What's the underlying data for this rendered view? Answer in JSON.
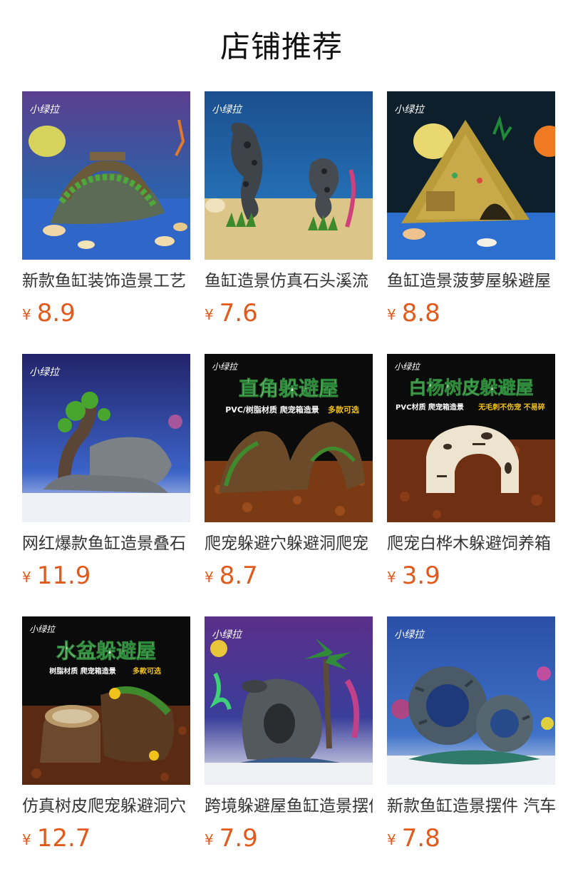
{
  "section": {
    "title": "店铺推荐"
  },
  "brand": {
    "logo_text": "小绿拉"
  },
  "colors": {
    "price": "#e05a1c",
    "title": "#111111",
    "name": "#333333"
  },
  "products": [
    {
      "name": "新款鱼缸装饰造景工艺",
      "currency": "¥",
      "price": "8.9",
      "image_icon": "aquarium-bridge-ornament-image"
    },
    {
      "name": "鱼缸造景仿真石头溪流",
      "currency": "¥",
      "price": "7.6",
      "image_icon": "aquarium-rock-ornament-image"
    },
    {
      "name": "鱼缸造景菠萝屋躲避屋",
      "currency": "¥",
      "price": "8.8",
      "image_icon": "aquarium-treasure-pyramid-image"
    },
    {
      "name": "网红爆款鱼缸造景叠石",
      "currency": "¥",
      "price": "11.9",
      "image_icon": "aquarium-tree-rock-image"
    },
    {
      "name": "爬宠躲避穴躲避洞爬宠",
      "currency": "¥",
      "price": "8.7",
      "image_icon": "reptile-hide-cave-image",
      "banner": {
        "title": "直角躲避屋",
        "line": "PVC/树脂材质  爬宠箱造景",
        "highlight": "多款可选"
      }
    },
    {
      "name": "爬宠白桦木躲避饲养箱",
      "currency": "¥",
      "price": "3.9",
      "image_icon": "birch-bark-hide-image",
      "banner": {
        "title": "白杨树皮躲避屋",
        "line": "PVC材质  爬宠箱造景",
        "highlight": "无毛刺不伤宠  不易碎"
      }
    },
    {
      "name": "仿真树皮爬宠躲避洞穴",
      "currency": "¥",
      "price": "12.7",
      "image_icon": "bark-basin-hide-image",
      "banner": {
        "title": "水盆躲避屋",
        "line": "树脂材质  爬宠箱造景",
        "highlight": "多款可选"
      }
    },
    {
      "name": "跨境躲避屋鱼缸造景摆件",
      "currency": "¥",
      "price": "7.9",
      "image_icon": "aquarium-urn-palm-image"
    },
    {
      "name": "新款鱼缸造景摆件 汽车",
      "currency": "¥",
      "price": "7.8",
      "image_icon": "aquarium-tire-ornament-image"
    }
  ]
}
